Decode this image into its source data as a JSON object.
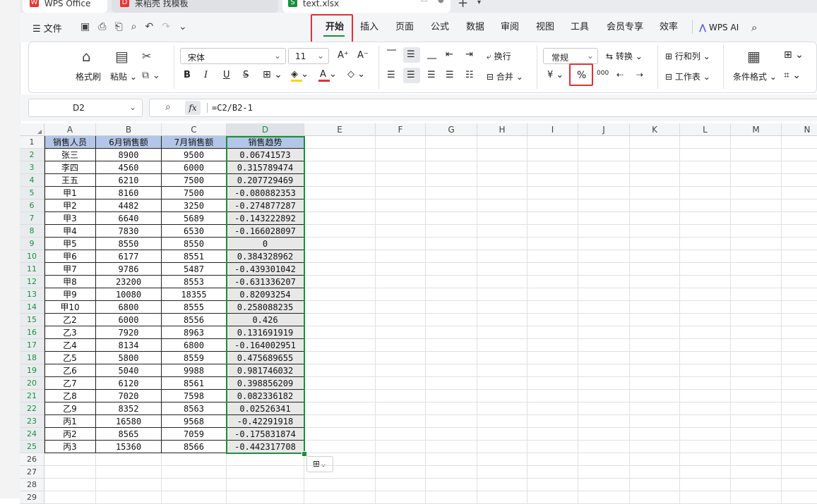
{
  "titlebar": {
    "tabs": [
      {
        "label": "WPS Office"
      },
      {
        "label": "来稻壳 找模板"
      },
      {
        "label": "text.xlsx"
      }
    ],
    "new_tab": "+"
  },
  "ribbon_tabs": [
    "开始",
    "插入",
    "页面",
    "公式",
    "数据",
    "审阅",
    "视图",
    "工具",
    "会员专享",
    "效率"
  ],
  "menu": {
    "file": "文件",
    "ai": "WPS AI"
  },
  "toolbar": {
    "format_brush": "格式刷",
    "paste": "粘贴",
    "font": "宋体",
    "size": "11",
    "bold": "B",
    "italic": "I",
    "underline": "U",
    "strike": "S",
    "wrap": "换行",
    "merge": "合并",
    "number_format": "常规",
    "convert": "转换",
    "row_col": "行和列",
    "worksheet": "工作表",
    "cond_format": "条件格式",
    "currency": "¥",
    "percent": "%",
    "thousands": "000"
  },
  "formula_bar": {
    "name_box": "D2",
    "fx": "fx",
    "formula": "=C2/B2-1"
  },
  "columns": [
    "A",
    "B",
    "C",
    "D",
    "E",
    "F",
    "G",
    "H",
    "I",
    "J",
    "K",
    "L",
    "M",
    "N"
  ],
  "rows": [
    "1",
    "2",
    "3",
    "4",
    "5",
    "6",
    "7",
    "8",
    "9",
    "10",
    "11",
    "12",
    "13",
    "14",
    "15",
    "16",
    "17",
    "18",
    "19",
    "20",
    "21",
    "22",
    "23",
    "24",
    "25",
    "26",
    "27",
    "28",
    "29"
  ],
  "table": {
    "headers": [
      "销售人员",
      "6月销售额",
      "7月销售额",
      "销售趋势"
    ],
    "rows": [
      [
        "张三",
        "8900",
        "9500",
        "0.06741573"
      ],
      [
        "李四",
        "4560",
        "6000",
        "0.315789474"
      ],
      [
        "王五",
        "6210",
        "7500",
        "0.207729469"
      ],
      [
        "甲1",
        "8160",
        "7500",
        "-0.080882353"
      ],
      [
        "甲2",
        "4482",
        "3250",
        "-0.274877287"
      ],
      [
        "甲3",
        "6640",
        "5689",
        "-0.143222892"
      ],
      [
        "甲4",
        "7830",
        "6530",
        "-0.166028097"
      ],
      [
        "甲5",
        "8550",
        "8550",
        "0"
      ],
      [
        "甲6",
        "6177",
        "8551",
        "0.384328962"
      ],
      [
        "甲7",
        "9786",
        "5487",
        "-0.439301042"
      ],
      [
        "甲8",
        "23200",
        "8553",
        "-0.631336207"
      ],
      [
        "甲9",
        "10080",
        "18355",
        "0.82093254"
      ],
      [
        "甲10",
        "6800",
        "8555",
        "0.258088235"
      ],
      [
        "乙2",
        "6000",
        "8556",
        "0.426"
      ],
      [
        "乙3",
        "7920",
        "8963",
        "0.131691919"
      ],
      [
        "乙4",
        "8134",
        "6800",
        "-0.164002951"
      ],
      [
        "乙5",
        "5800",
        "8559",
        "0.475689655"
      ],
      [
        "乙6",
        "5040",
        "9988",
        "0.981746032"
      ],
      [
        "乙7",
        "6120",
        "8561",
        "0.398856209"
      ],
      [
        "乙8",
        "7020",
        "7598",
        "0.082336182"
      ],
      [
        "乙9",
        "8352",
        "8563",
        "0.02526341"
      ],
      [
        "丙1",
        "16580",
        "9568",
        "-0.42291918"
      ],
      [
        "丙2",
        "8565",
        "7059",
        "-0.175831874"
      ],
      [
        "丙3",
        "15360",
        "8566",
        "-0.442317708"
      ]
    ]
  },
  "colors": {
    "accent": "#1a8f3c",
    "highlight": "#e03131",
    "header_fill": "#b4c6e7"
  }
}
